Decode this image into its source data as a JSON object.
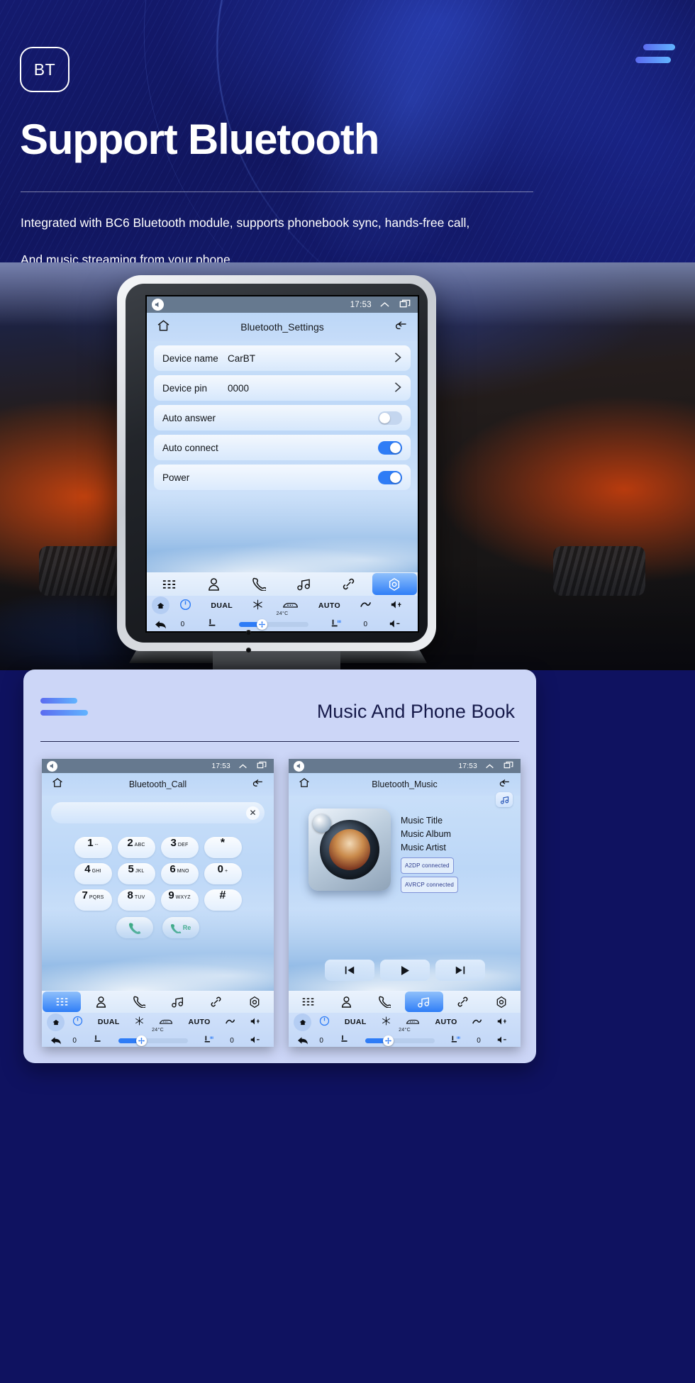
{
  "hero": {
    "badge": "BT",
    "title": "Support Bluetooth",
    "subtitle_line1": "Integrated with BC6 Bluetooth module, supports phonebook sync, hands-free call,",
    "subtitle_line2": "And music streaming from your phone.",
    "accent": "#5b6bf0",
    "accent2": "#61b4ff"
  },
  "settings_screen": {
    "status": {
      "time": "17:53",
      "speaker_icon": "speaker-mute-icon",
      "expand_icon": "chevron-up-icon",
      "recents_icon": "recents-icon"
    },
    "titlebar": {
      "home_icon": "home-icon",
      "title": "Bluetooth_Settings",
      "back_icon": "back-arrow-icon"
    },
    "rows": [
      {
        "label": "Device name",
        "value": "CarBT",
        "control": "chevron"
      },
      {
        "label": "Device pin",
        "value": "0000",
        "control": "chevron"
      },
      {
        "label": "Auto answer",
        "value": "",
        "control": "toggle",
        "state": "off"
      },
      {
        "label": "Auto connect",
        "value": "",
        "control": "toggle",
        "state": "on"
      },
      {
        "label": "Power",
        "value": "",
        "control": "toggle",
        "state": "on"
      }
    ],
    "dock": [
      {
        "name": "apps-icon",
        "selected": false
      },
      {
        "name": "contact-icon",
        "selected": false
      },
      {
        "name": "phone-icon",
        "selected": false
      },
      {
        "name": "music-icon",
        "selected": false
      },
      {
        "name": "link-icon",
        "selected": false
      },
      {
        "name": "bluetooth-settings-icon",
        "selected": true
      }
    ],
    "climate": {
      "power_icon": "power-icon",
      "dual": "DUAL",
      "snow_icon": "snowflake-icon",
      "defrost_icon": "rear-defrost-icon",
      "auto": "AUTO",
      "airflow_icon": "airflow-icon",
      "vol_up_icon": "volume-up-icon",
      "temp": "24°C",
      "back_icon": "back-arrow-icon",
      "left_value": "0",
      "seat_icon": "seat-icon",
      "fan_icon": "fan-icon",
      "heated_seat_icon": "heated-seat-icon",
      "right_value": "0",
      "vol_down_icon": "volume-down-icon",
      "home_icon": "home-icon",
      "slider_percent": 33
    }
  },
  "bottom_card": {
    "title": "Music And Phone Book",
    "call_screen": {
      "status": {
        "time": "17:53"
      },
      "titlebar": {
        "title": "Bluetooth_Call"
      },
      "search_value": "",
      "search_placeholder": "",
      "clear_icon": "close-icon",
      "keys": [
        {
          "digit": "1",
          "letters": "--"
        },
        {
          "digit": "2",
          "letters": "ABC"
        },
        {
          "digit": "3",
          "letters": "DEF"
        },
        {
          "digit": "*",
          "letters": ""
        },
        {
          "digit": "4",
          "letters": "GHI"
        },
        {
          "digit": "5",
          "letters": "JKL"
        },
        {
          "digit": "6",
          "letters": "MNO"
        },
        {
          "digit": "0",
          "letters": "+"
        },
        {
          "digit": "7",
          "letters": "PQRS"
        },
        {
          "digit": "8",
          "letters": "TUV"
        },
        {
          "digit": "9",
          "letters": "WXYZ"
        },
        {
          "digit": "#",
          "letters": ""
        }
      ],
      "call_icon": "phone-call-icon",
      "redial_label": "Re",
      "redial_icon": "redial-icon",
      "dock_selected_index": 0
    },
    "music_screen": {
      "status": {
        "time": "17:53"
      },
      "titlebar": {
        "title": "Bluetooth_Music"
      },
      "list_icon": "music-list-icon",
      "track_title": "Music Title",
      "track_album": "Music Album",
      "track_artist": "Music Artist",
      "badge_a2dp": "A2DP  connected",
      "badge_avrcp": "AVRCP  connected",
      "prev_icon": "previous-track-icon",
      "play_icon": "play-icon",
      "next_icon": "next-track-icon",
      "dock_selected_index": 3
    }
  }
}
